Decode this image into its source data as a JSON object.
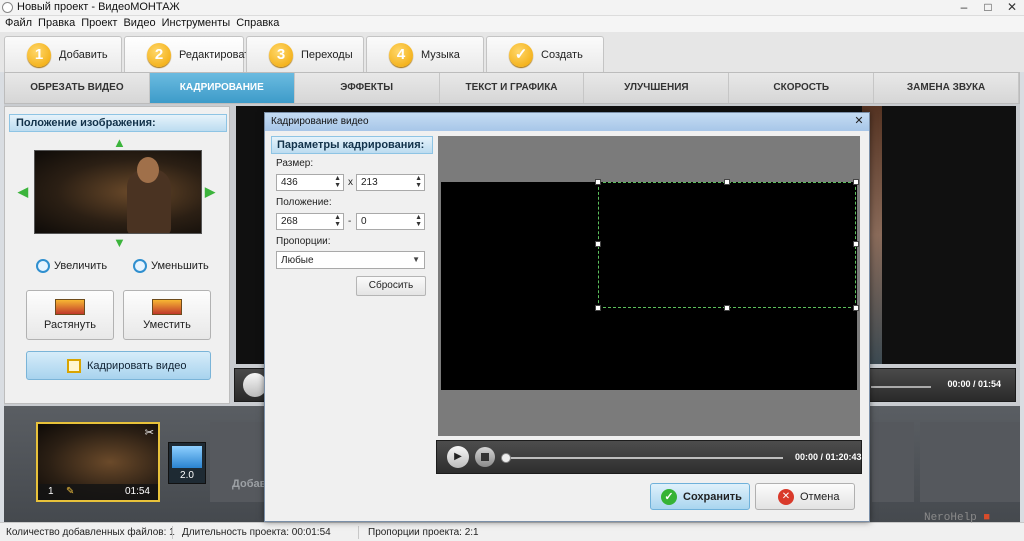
{
  "window": {
    "title": "Новый проект - ВидеоМОНТАЖ"
  },
  "menu": [
    "Файл",
    "Правка",
    "Проект",
    "Видео",
    "Инструменты",
    "Справка"
  ],
  "steps": [
    {
      "num": "1",
      "label": "Добавить"
    },
    {
      "num": "2",
      "label": "Редактировать"
    },
    {
      "num": "3",
      "label": "Переходы"
    },
    {
      "num": "4",
      "label": "Музыка"
    },
    {
      "num": "",
      "label": "Создать"
    }
  ],
  "subtabs": [
    "ОБРЕЗАТЬ ВИДЕО",
    "КАДРИРОВАНИЕ",
    "ЭФФЕКТЫ",
    "ТЕКСТ И ГРАФИКА",
    "УЛУЧШЕНИЯ",
    "СКОРОСТЬ",
    "ЗАМЕНА ЗВУКА"
  ],
  "left_panel": {
    "title": "Положение изображения:",
    "zoom_in": "Увеличить",
    "zoom_out": "Уменьшить",
    "stretch": "Растянуть",
    "fit": "Уместить",
    "crop_video": "Кадрировать видео"
  },
  "player": {
    "time": "00:00 / 01:54"
  },
  "timeline": {
    "clip_index": "1",
    "clip_duration": "01:54",
    "transition_value": "2.0",
    "add_label": "Добав"
  },
  "status": {
    "files": "Количество добавленных файлов: 1",
    "duration": "Длительность проекта:  00:01:54",
    "proportions": "Пропорции проекта:  2:1"
  },
  "watermark": {
    "text": "NeroHelp"
  },
  "dialog": {
    "title": "Кадрирование видео",
    "params_title": "Параметры кадрирования:",
    "size_label": "Размер:",
    "width": "436",
    "times": "x",
    "height": "213",
    "position_label": "Положение:",
    "pos_x": "268",
    "dash": "-",
    "pos_y": "0",
    "proportions_label": "Пропорции:",
    "proportions_value": "Любые",
    "reset": "Сбросить",
    "player_time": "00:00 / 01:20:43",
    "save": "Сохранить",
    "cancel": "Отмена"
  }
}
